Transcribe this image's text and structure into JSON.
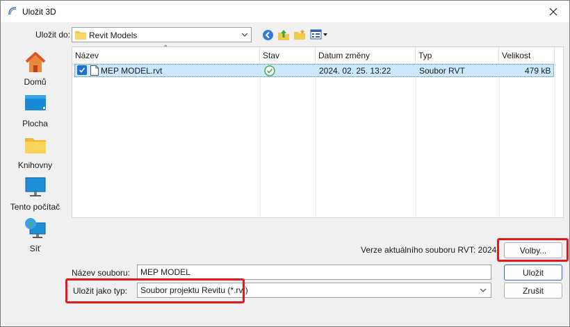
{
  "window": {
    "title": "Uložit 3D"
  },
  "toolbar": {
    "save_in_label": "Uložit do:",
    "save_in_value": "Revit Models"
  },
  "places": [
    {
      "label": "Domů"
    },
    {
      "label": "Plocha"
    },
    {
      "label": "Knihovny"
    },
    {
      "label": "Tento počítač"
    },
    {
      "label": "Síť"
    }
  ],
  "file_list": {
    "columns": [
      "Název",
      "Stav",
      "Datum změny",
      "Typ",
      "Velikost"
    ],
    "rows": [
      {
        "name": "MEP MODEL.rvt",
        "status": "synced",
        "date": "2024. 02. 25. 13:22",
        "type": "Soubor RVT",
        "size": "479 kB"
      }
    ]
  },
  "footer": {
    "version_text": "Verze aktuálního souboru RVT: 2024",
    "options_button": "Volby...",
    "filename_label": "Název souboru:",
    "filename_value": "MEP MODEL",
    "filetype_label": "Uložit jako typ:",
    "filetype_value": "Soubor projektu Revitu (*.rvt)",
    "save_button": "Uložit",
    "cancel_button": "Zrušit"
  },
  "colors": {
    "highlight": "#e41a1a",
    "selection": "#cce8ff",
    "accent": "#1f6ed4"
  },
  "icons": [
    "revit-icon",
    "close-icon",
    "back-icon",
    "up-folder-icon",
    "new-folder-icon",
    "view-menu-icon",
    "home-icon",
    "desktop-icon",
    "libraries-icon",
    "this-pc-icon",
    "network-icon",
    "sync-status-icon",
    "file-icon",
    "checkbox-icon"
  ]
}
